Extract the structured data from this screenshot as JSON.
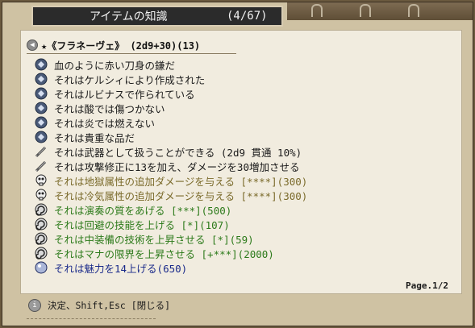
{
  "window": {
    "title": "アイテムの知識",
    "count": "(4/67)"
  },
  "item_header": "★《フラネーヴェ》 (2d9+30)(13)",
  "lines": [
    {
      "text": "血のように赤い刀身の鎌だ",
      "icon": "gem-icon",
      "color": "black"
    },
    {
      "text": "それはケルシィにより作成された",
      "icon": "gem-icon",
      "color": "black"
    },
    {
      "text": "それはルビナスで作られている",
      "icon": "gem-icon",
      "color": "black"
    },
    {
      "text": "それは酸では傷つかない",
      "icon": "gem-icon",
      "color": "black"
    },
    {
      "text": "それは炎では燃えない",
      "icon": "gem-icon",
      "color": "black"
    },
    {
      "text": "それは貴重な品だ",
      "icon": "gem-icon",
      "color": "black"
    },
    {
      "text": "それは武器として扱うことができる (2d9 貫通 10%)",
      "icon": "sword-icon",
      "color": "black"
    },
    {
      "text": "それは攻撃修正に13を加え、ダメージを30増加させる",
      "icon": "sword-icon",
      "color": "black"
    },
    {
      "text": "それは地獄属性の追加ダメージを与える [****](300)",
      "icon": "skull-icon",
      "color": "olive"
    },
    {
      "text": "それは冷気属性の追加ダメージを与える [****](300)",
      "icon": "skull-icon",
      "color": "olive"
    },
    {
      "text": "それは演奏の質をあげる [***](500)",
      "icon": "spiral-icon",
      "color": "green"
    },
    {
      "text": "それは回避の技能を上げる [*](107)",
      "icon": "spiral-icon",
      "color": "green"
    },
    {
      "text": "それは中装備の技術を上昇させる [*](59)",
      "icon": "spiral-icon",
      "color": "green"
    },
    {
      "text": "それはマナの限界を上昇させる [+***](2000)",
      "icon": "spiral-icon",
      "color": "green"
    },
    {
      "text": "それは魅力を14上げる(650)",
      "icon": "orb-icon",
      "color": "blue"
    }
  ],
  "page_indicator": "Page.1/2",
  "footer_hint": "決定、Shift,Esc [閉じる]"
}
